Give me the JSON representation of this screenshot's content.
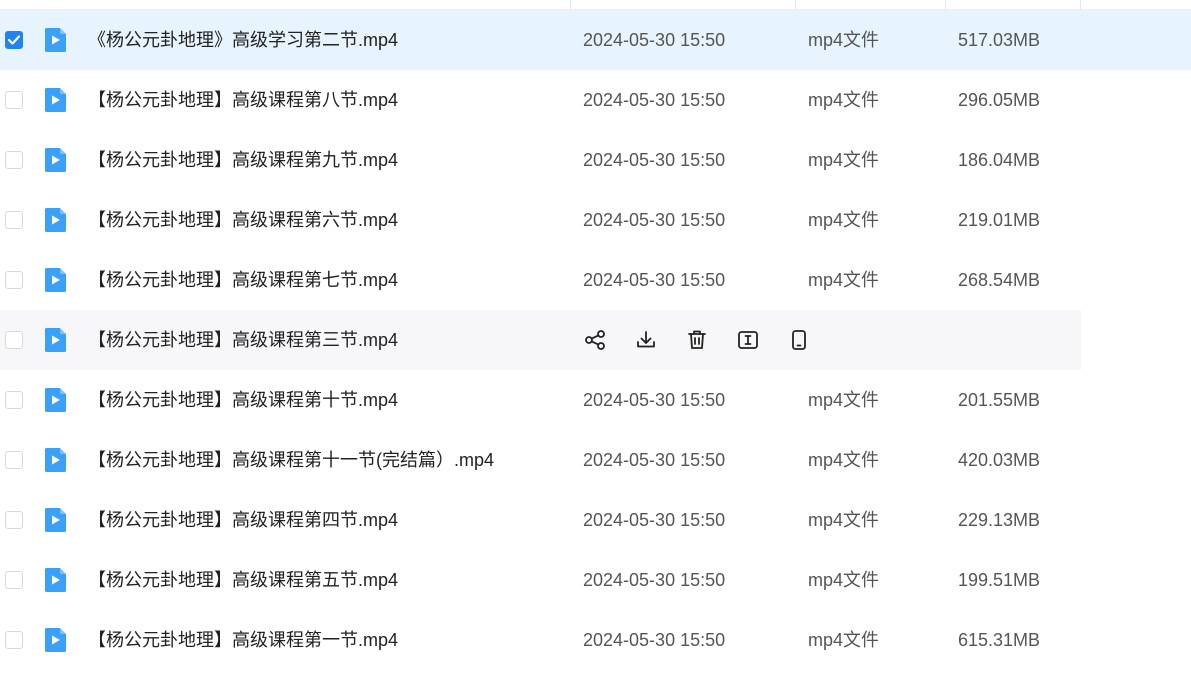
{
  "accent_color": "#1f84f2",
  "file_icon_color": "#3aa0f8",
  "files": [
    {
      "name": "《杨公元卦地理》高级学习第二节.mp4",
      "date": "2024-05-30 15:50",
      "type": "mp4文件",
      "size": "517.03MB",
      "checked": true,
      "state": "selected"
    },
    {
      "name": "【杨公元卦地理】高级课程第八节.mp4",
      "date": "2024-05-30 15:50",
      "type": "mp4文件",
      "size": "296.05MB",
      "checked": false,
      "state": "normal"
    },
    {
      "name": "【杨公元卦地理】高级课程第九节.mp4",
      "date": "2024-05-30 15:50",
      "type": "mp4文件",
      "size": "186.04MB",
      "checked": false,
      "state": "normal"
    },
    {
      "name": "【杨公元卦地理】高级课程第六节.mp4",
      "date": "2024-05-30 15:50",
      "type": "mp4文件",
      "size": "219.01MB",
      "checked": false,
      "state": "normal"
    },
    {
      "name": "【杨公元卦地理】高级课程第七节.mp4",
      "date": "2024-05-30 15:50",
      "type": "mp4文件",
      "size": "268.54MB",
      "checked": false,
      "state": "normal"
    },
    {
      "name": "【杨公元卦地理】高级课程第三节.mp4",
      "date": "",
      "type": "",
      "size": "",
      "checked": false,
      "state": "hover"
    },
    {
      "name": "【杨公元卦地理】高级课程第十节.mp4",
      "date": "2024-05-30 15:50",
      "type": "mp4文件",
      "size": "201.55MB",
      "checked": false,
      "state": "normal"
    },
    {
      "name": "【杨公元卦地理】高级课程第十一节(完结篇）.mp4",
      "date": "2024-05-30 15:50",
      "type": "mp4文件",
      "size": "420.03MB",
      "checked": false,
      "state": "normal"
    },
    {
      "name": "【杨公元卦地理】高级课程第四节.mp4",
      "date": "2024-05-30 15:50",
      "type": "mp4文件",
      "size": "229.13MB",
      "checked": false,
      "state": "normal"
    },
    {
      "name": "【杨公元卦地理】高级课程第五节.mp4",
      "date": "2024-05-30 15:50",
      "type": "mp4文件",
      "size": "199.51MB",
      "checked": false,
      "state": "normal"
    },
    {
      "name": "【杨公元卦地理】高级课程第一节.mp4",
      "date": "2024-05-30 15:50",
      "type": "mp4文件",
      "size": "615.31MB",
      "checked": false,
      "state": "normal"
    }
  ],
  "hover_actions": [
    {
      "icon": "share-icon"
    },
    {
      "icon": "download-icon"
    },
    {
      "icon": "delete-icon"
    },
    {
      "icon": "rename-icon"
    },
    {
      "icon": "send-to-phone-icon"
    }
  ]
}
